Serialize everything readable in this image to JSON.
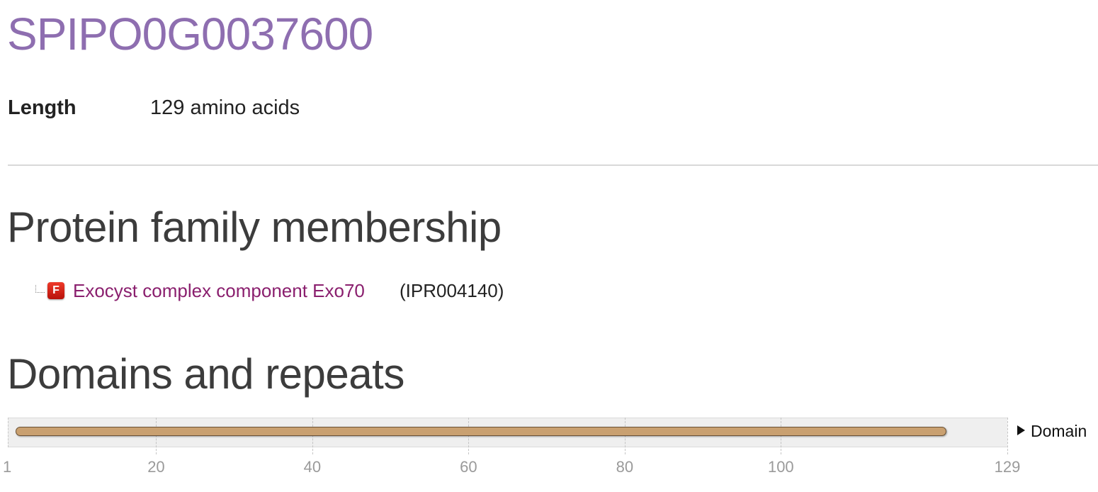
{
  "protein": {
    "title": "SPIPO0G0037600",
    "length_label": "Length",
    "length_value": "129 amino acids"
  },
  "family_section": {
    "heading": "Protein family membership",
    "entries": [
      {
        "icon_letter": "F",
        "icon": "family-icon",
        "name": "Exocyst complex component Exo70",
        "accession": "(IPR004140)"
      }
    ]
  },
  "domains_section": {
    "heading": "Domains and repeats",
    "legend_label": "Domain",
    "axis_min": 1,
    "axis_max": 129,
    "ticks": [
      "1",
      "20",
      "40",
      "60",
      "80",
      "100",
      "129"
    ],
    "gridline_values": [
      20,
      40,
      60,
      80,
      100,
      129
    ],
    "domains": [
      {
        "start": 2,
        "end": 121,
        "color": "#c9a070"
      }
    ]
  },
  "colors": {
    "title": "#8e6eb0",
    "family_link": "#8a1f6e",
    "domain": "#c9a070"
  }
}
